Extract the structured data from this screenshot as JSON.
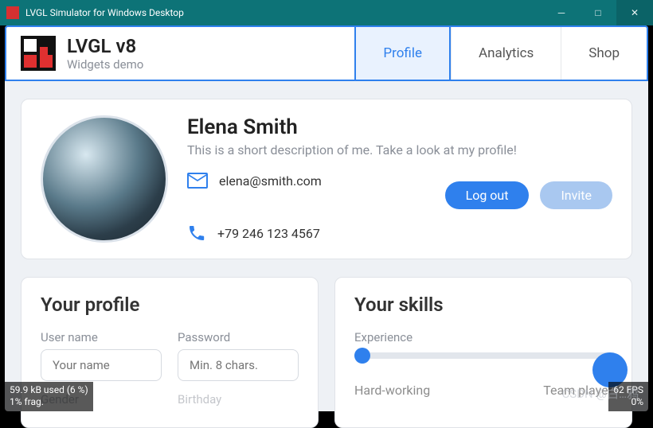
{
  "window": {
    "title": "LVGL Simulator for Windows Desktop"
  },
  "brand": {
    "title": "LVGL v8",
    "subtitle": "Widgets demo"
  },
  "tabs": {
    "profile": "Profile",
    "analytics": "Analytics",
    "shop": "Shop"
  },
  "profile": {
    "name": "Elena Smith",
    "description": "This is a short description of me. Take a look at my profile!",
    "email": "elena@smith.com",
    "phone": "+79 246 123 4567",
    "buttons": {
      "logout": "Log out",
      "invite": "Invite"
    }
  },
  "form": {
    "title": "Your profile",
    "username": {
      "label": "User name",
      "placeholder": "Your name"
    },
    "password": {
      "label": "Password",
      "placeholder": "Min. 8 chars."
    },
    "gender": {
      "label": "Gender"
    },
    "birthday": {
      "label": "Birthday"
    }
  },
  "skills": {
    "title": "Your skills",
    "experience": "Experience",
    "hard_working": "Hard-working",
    "team_player": "Team player"
  },
  "stats": {
    "mem": "59.9 kB used (6 %)",
    "frag": "1% frag.",
    "fps": "62 FPS",
    "cpu": "0%"
  },
  "watermark": "CSDN @白…鸦"
}
